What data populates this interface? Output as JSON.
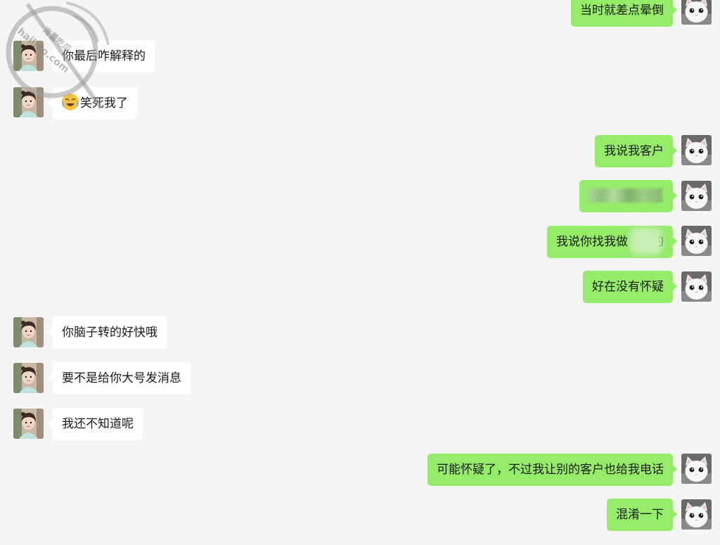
{
  "watermark": {
    "text1": "海量吃瓜",
    "text2": "hailiao.com"
  },
  "messages": [
    {
      "side": "out",
      "text": "当时就差点晕倒"
    },
    {
      "side": "in",
      "text": "你最后咋解释的"
    },
    {
      "side": "in",
      "text": "笑死我了",
      "emoji": "laughing-crying-emoji"
    },
    {
      "side": "out",
      "text": "我说我客户"
    },
    {
      "side": "out",
      "text": "",
      "redacted": true
    },
    {
      "side": "out",
      "text": "我说你找我做",
      "tail": "的"
    },
    {
      "side": "out",
      "text": "好在没有怀疑"
    },
    {
      "side": "in",
      "text": "你脑子转的好快哦"
    },
    {
      "side": "in",
      "text": "要不是给你大号发消息"
    },
    {
      "side": "in",
      "text": "我还不知道呢"
    },
    {
      "side": "out",
      "text": "可能怀疑了，不过我让别的客户也给我电话"
    },
    {
      "side": "out",
      "text": "混淆一下"
    }
  ],
  "colors": {
    "background": "#f5f5f5",
    "incoming": "#ffffff",
    "outgoing": "#95ec69"
  },
  "avatars": {
    "incoming": "girl-avatar",
    "outgoing": "white-cat-avatar"
  }
}
